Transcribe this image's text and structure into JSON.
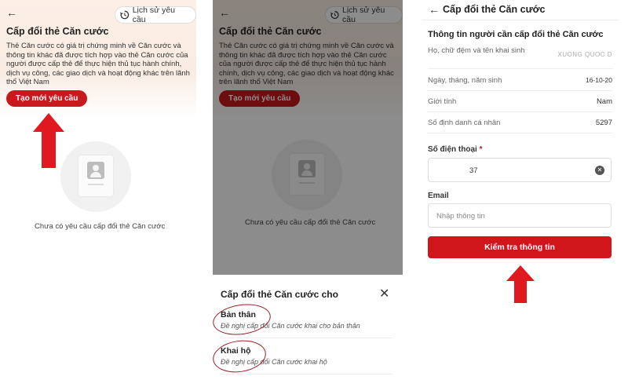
{
  "colors": {
    "brand_red": "#c8191e",
    "arrow_red": "#e0181f",
    "oval": "#9b2226"
  },
  "screen1": {
    "back_icon": "arrow-left-icon",
    "history_label": "Lịch sử yêu cầu",
    "title": "Cấp đổi thẻ Căn cước",
    "description": "Thẻ Căn cước có giá trị chứng minh về Căn cước và thông tin khác đã được tích hợp vào thẻ Căn cước của người được cấp thẻ để thực hiện thủ tục hành chính, dịch vụ công, các giao dịch và hoạt động khác trên lãnh thổ Việt Nam",
    "create_button": "Tạo mới yêu cầu",
    "empty_text": "Chưa có yêu cầu cấp đổi thẻ Căn cước"
  },
  "screen2": {
    "history_label": "Lịch sử yêu cầu",
    "title": "Cấp đổi thẻ Căn cước",
    "description": "Thẻ Căn cước có giá trị chứng minh về Căn cước và thông tin khác đã được tích hợp vào thẻ Căn cước của người được cấp thẻ để thực hiện thủ tục hành chính, dịch vụ công, các giao dịch và hoạt động khác trên lãnh thổ Việt Nam",
    "create_button": "Tạo mới yêu cầu",
    "empty_text": "Chưa có yêu cầu cấp đổi thẻ Căn cước",
    "sheet": {
      "title": "Cấp đổi thẻ Căn cước cho",
      "options": [
        {
          "title": "Bản thân",
          "subtitle": "Đề nghị cấp đổi Căn cước khai cho bản thân"
        },
        {
          "title": "Khai hộ",
          "subtitle": "Đề nghị cấp đổi Căn cước khai hộ"
        }
      ]
    }
  },
  "screen3": {
    "title": "Cấp đổi thẻ Căn cước",
    "section_title": "Thông tin người cần cấp đổi thẻ Căn cước",
    "rows": [
      {
        "label": "Họ, chữ đệm và tên khai sinh",
        "value": "XUONG QUOC D"
      },
      {
        "label": "Ngày, tháng, năm sinh",
        "value": "16-10-20"
      },
      {
        "label": "Giới tính",
        "value": "Nam"
      },
      {
        "label": "Số định danh cá nhân",
        "value": "5297"
      }
    ],
    "phone_label": "Số điện thoại",
    "phone_required": "*",
    "phone_value": "37",
    "email_label": "Email",
    "email_placeholder": "Nhập thông tin",
    "submit_button": "Kiểm tra thông tin"
  }
}
